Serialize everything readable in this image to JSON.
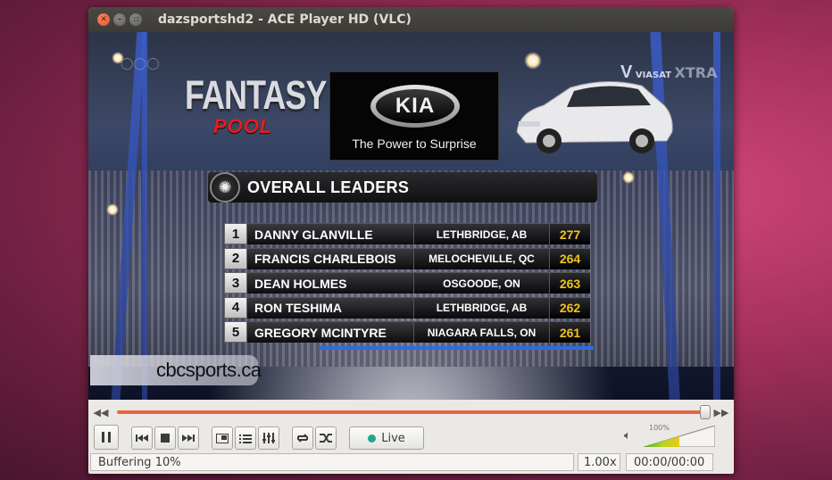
{
  "window": {
    "title": "dazsportshd2 - ACE Player HD (VLC)"
  },
  "video": {
    "fantasy_line1": "FANTASY",
    "fantasy_line2": "POOL",
    "kia_logo": "KIA",
    "kia_tagline": "The Power to Surprise",
    "channel_logo": "VIASAT",
    "channel_sub": "XTRA",
    "board_title": "OVERALL LEADERS",
    "url": "cbcsports.ca",
    "leaders": [
      {
        "rank": "1",
        "name": "DANNY GLANVILLE",
        "location": "LETHBRIDGE, AB",
        "score": "277"
      },
      {
        "rank": "2",
        "name": "FRANCIS CHARLEBOIS",
        "location": "MELOCHEVILLE, QC",
        "score": "264"
      },
      {
        "rank": "3",
        "name": "DEAN HOLMES",
        "location": "OSGOODE, ON",
        "score": "263"
      },
      {
        "rank": "4",
        "name": "RON TESHIMA",
        "location": "LETHBRIDGE, AB",
        "score": "262"
      },
      {
        "rank": "5",
        "name": "GREGORY MCINTYRE",
        "location": "NIAGARA FALLS, ON",
        "score": "261"
      }
    ]
  },
  "controls": {
    "seek_progress": 1.0,
    "live_label": "Live",
    "volume_label": "100%",
    "volume_level": 1.0,
    "accent": "#e8663d"
  },
  "status": {
    "message": "Buffering 10%",
    "speed": "1.00x",
    "time": "00:00/00:00"
  }
}
